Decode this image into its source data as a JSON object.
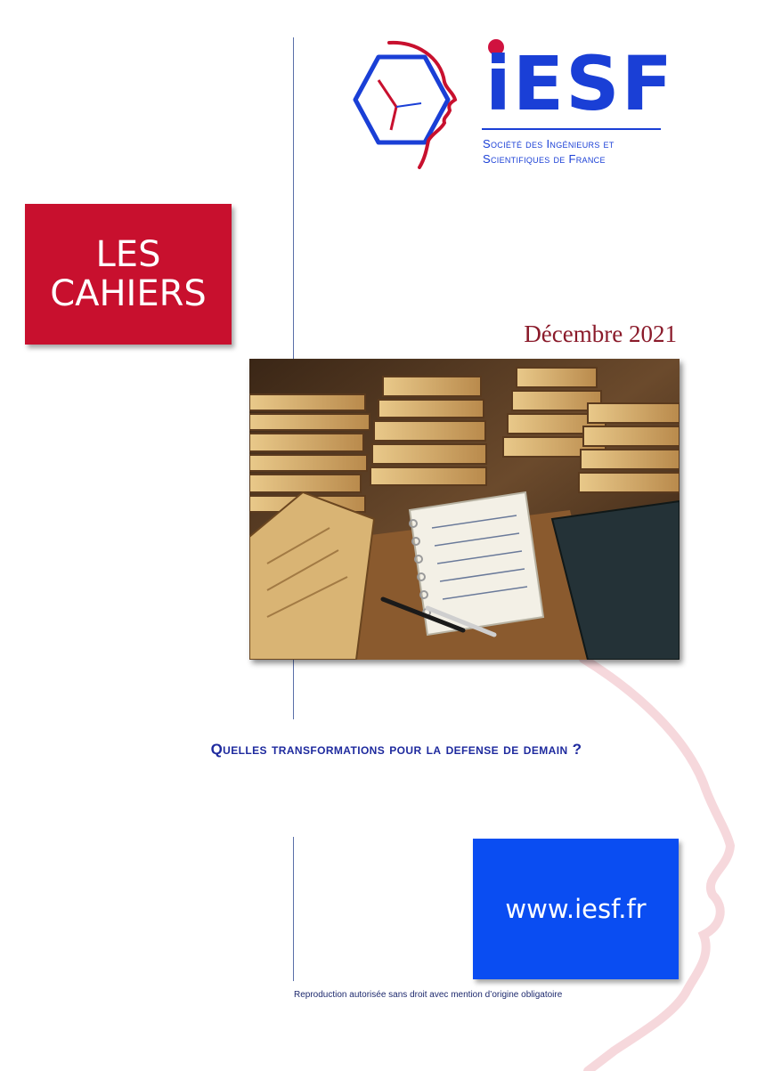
{
  "logo": {
    "name": "iESF",
    "subtitle_line1": "Société des Ingénieurs et",
    "subtitle_line2": "Scientifiques de France"
  },
  "banner": {
    "line1": "LES",
    "line2": "CAHIERS"
  },
  "date": "Décembre 2021",
  "photo": {
    "icon": "books-notebook-photo"
  },
  "title": "Quelles transformations pour la defense de demain ?",
  "website": "www.iesf.fr",
  "footer": "Reproduction autorisée sans droit avec mention d’origine obligatoire",
  "colors": {
    "brand_blue": "#1a3fd6",
    "brand_red": "#c8102e",
    "website_blue": "#0a4df2",
    "title_blue": "#1e2a9e",
    "date_red": "#8a1a2a"
  }
}
